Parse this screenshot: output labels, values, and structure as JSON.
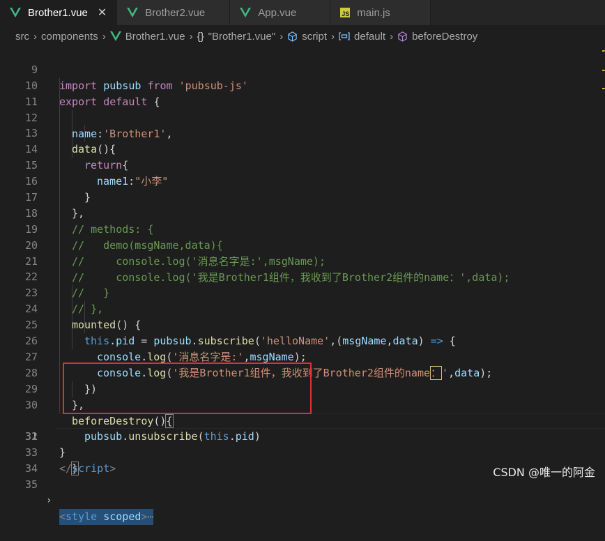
{
  "tabs": [
    {
      "label": "Brother1.vue",
      "icon": "vue-icon",
      "active": true,
      "close": "✕"
    },
    {
      "label": "Brother2.vue",
      "icon": "vue-icon",
      "active": false
    },
    {
      "label": "App.vue",
      "icon": "vue-icon",
      "active": false
    },
    {
      "label": "main.js",
      "icon": "js-icon",
      "active": false
    }
  ],
  "breadcrumb": {
    "src": "src",
    "components": "components",
    "file": "Brother1.vue",
    "obj": "\"Brother1.vue\"",
    "obj_icon": "{}",
    "script": "script",
    "default": "default",
    "method": "beforeDestroy"
  },
  "lines": [
    {
      "n": "9"
    },
    {
      "n": "10"
    },
    {
      "n": "11"
    },
    {
      "n": "12"
    },
    {
      "n": "13"
    },
    {
      "n": "14"
    },
    {
      "n": "15"
    },
    {
      "n": "16"
    },
    {
      "n": "17"
    },
    {
      "n": "18"
    },
    {
      "n": "19"
    },
    {
      "n": "20"
    },
    {
      "n": "21"
    },
    {
      "n": "22"
    },
    {
      "n": "23"
    },
    {
      "n": "24"
    },
    {
      "n": "25"
    },
    {
      "n": "26"
    },
    {
      "n": "27"
    },
    {
      "n": "28"
    },
    {
      "n": "29"
    },
    {
      "n": "30"
    },
    {
      "n": "31"
    },
    {
      "n": "32"
    },
    {
      "n": "33"
    },
    {
      "n": "34"
    },
    {
      "n": "35"
    }
  ],
  "code": {
    "l9": [
      "import",
      "pubsub",
      "from",
      "'pubsub-js'"
    ],
    "l10": [
      "export",
      "default",
      "{"
    ],
    "l11": [
      "name",
      ":",
      "'Brother1'",
      ","
    ],
    "l12": [
      "data",
      "(){"
    ],
    "l13": [
      "return",
      "{"
    ],
    "l14": [
      "name1",
      ":",
      "\"小李\""
    ],
    "l15": [
      "}"
    ],
    "l16": [
      "},"
    ],
    "l17": "// methods: {",
    "l18": "//   demo(msgName,data){",
    "l19": "//     console.log('消息名字是:',msgName);",
    "l20": "//     console.log('我是Brother1组件，我收到了Brother2组件的name：',data);",
    "l21": "//   }",
    "l22": "// },",
    "l23": [
      "mounted",
      "() {"
    ],
    "l24": [
      "this",
      ".",
      "pid",
      " = ",
      "pubsub",
      ".",
      "subscribe",
      "(",
      "'helloName'",
      ",(",
      "msgName",
      ",",
      "data",
      ") ",
      "=>",
      " {"
    ],
    "l25": [
      "console",
      ".",
      "log",
      "(",
      "'消息名字是:'",
      ",",
      "msgName",
      ");"
    ],
    "l26": [
      "console",
      ".",
      "log",
      "(",
      "'我是Brother1组件，我收到了Brother2组件的name",
      "：",
      "'",
      ",",
      "data",
      ");"
    ],
    "l27": [
      "})"
    ],
    "l28": [
      "},"
    ],
    "l29": [
      "beforeDestroy",
      "()",
      "{"
    ],
    "l30": [
      "pubsub",
      ".",
      "unsubscribe",
      "(",
      "this",
      ".",
      "pid",
      ")"
    ],
    "l31": [
      "}"
    ],
    "l32": [
      "}"
    ],
    "l33": [
      "</",
      "script",
      ">"
    ],
    "l34": [],
    "l35": [
      "<",
      "style",
      " ",
      "scoped",
      ">",
      "⋯"
    ]
  },
  "watermark": "CSDN @唯一的阿金",
  "colors": {
    "keyword": "#c586c0",
    "storage": "#569cd6",
    "string": "#ce9178",
    "variable": "#9cdcfe",
    "function": "#dcdcaa",
    "comment": "#6a9955",
    "highlight_box": "#e03131",
    "vue_green": "#41b883"
  }
}
